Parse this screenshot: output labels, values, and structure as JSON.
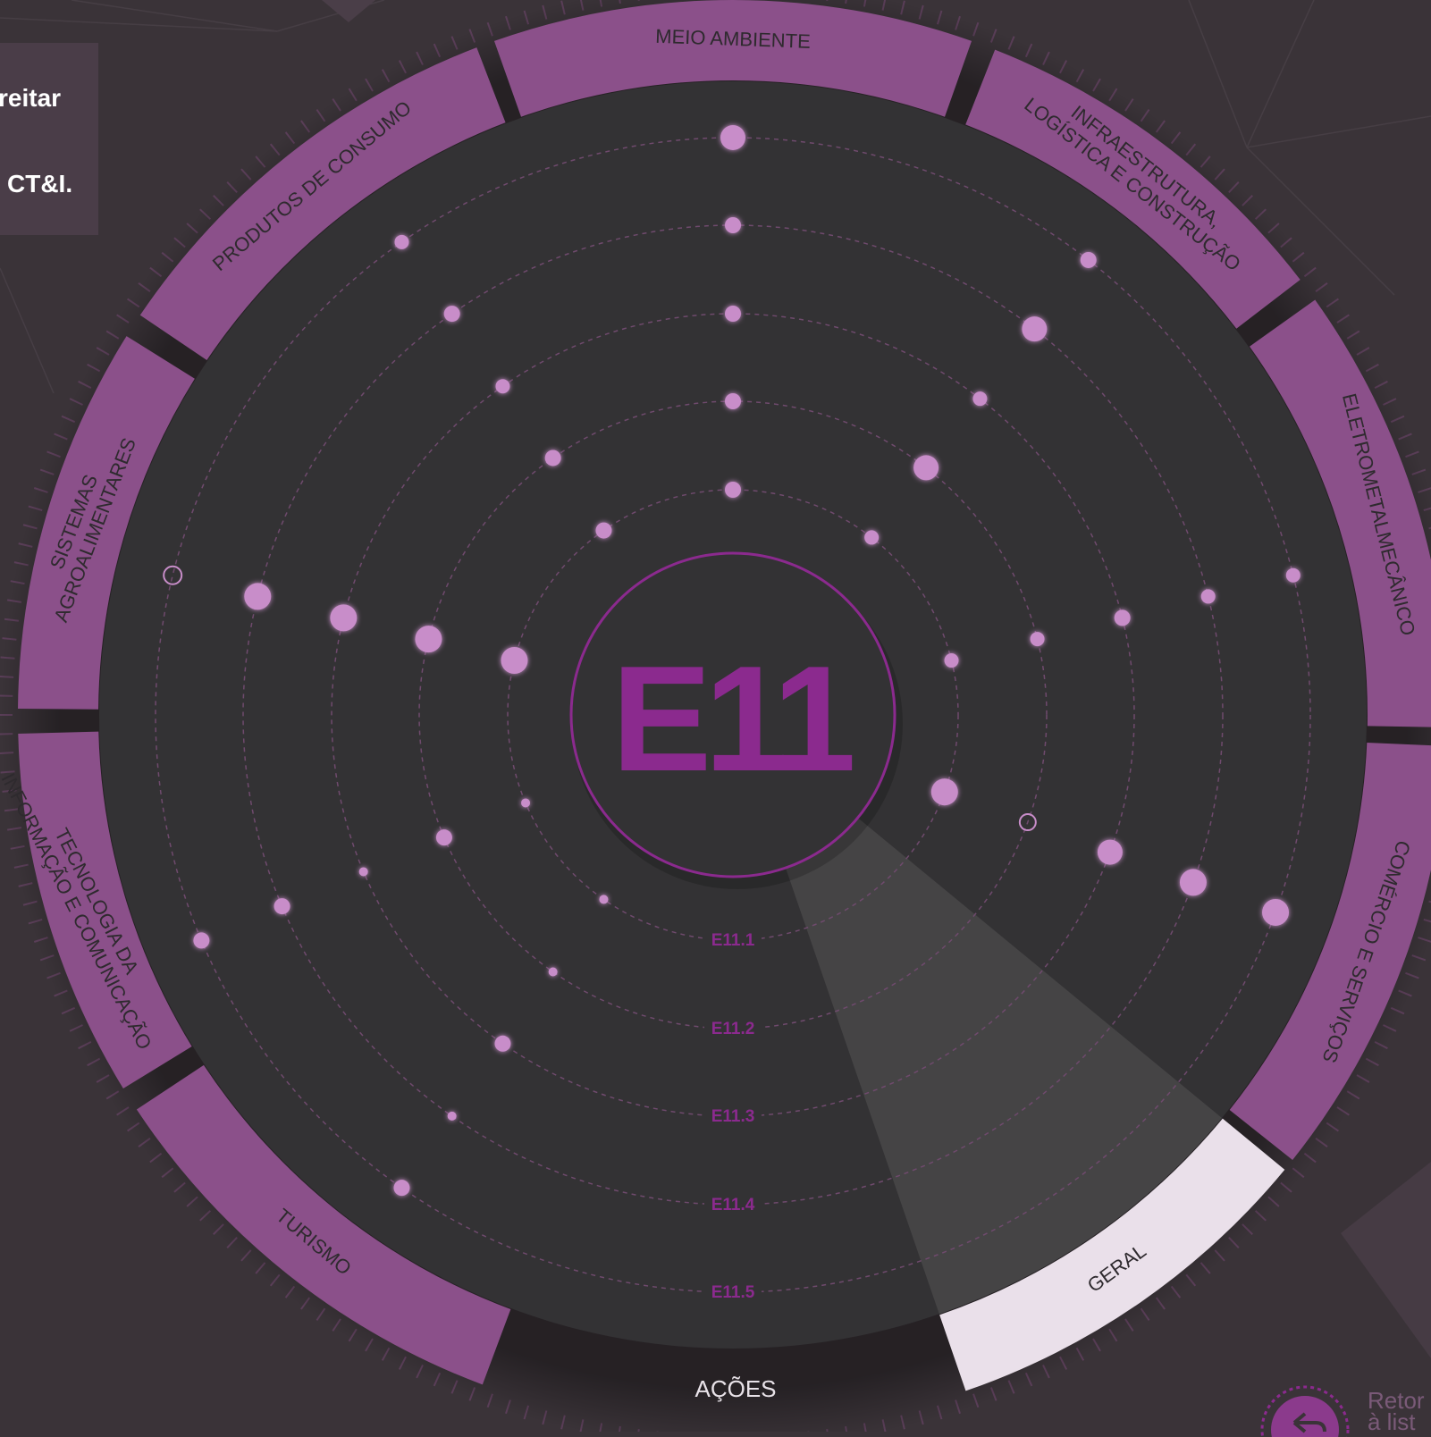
{
  "side_text": {
    "line1": "reitar",
    "line2": "CT&I."
  },
  "radar": {
    "center_label": "E11",
    "bottom_label": "AÇÕES",
    "rings": [
      "E11.1",
      "E11.2",
      "E11.3",
      "E11.4",
      "E11.5"
    ],
    "sectors": [
      {
        "label": "MEIO AMBIENTE",
        "highlight": false
      },
      {
        "label": "INFRAESTRUTURA,",
        "label2": "LOGÍSTICA E CONSTRUÇÃO",
        "highlight": false
      },
      {
        "label": "ELETROMETALMECÂNICO",
        "highlight": false
      },
      {
        "label": "COMÉRCIO E SERVIÇOS",
        "highlight": false
      },
      {
        "label": "GERAL",
        "highlight": true
      },
      {
        "label": "TURISMO",
        "highlight": false
      },
      {
        "label": "TECNOLOGIA DA",
        "label2": "INFORMAÇÃO E COMUNICAÇÃO",
        "highlight": false
      },
      {
        "label": "SISTEMAS",
        "label2": "AGROALIMENTARES",
        "highlight": false
      },
      {
        "label": "PRODUTOS DE CONSUMO",
        "highlight": false
      }
    ],
    "colors": {
      "background": "#3a3338",
      "inner_disc": "#333234",
      "sector": "#8b508a",
      "sector_highlight": "#eae0ea",
      "sector_text": "#2e2a2e",
      "accent": "#8b2a8e",
      "ring_line": "#6f4a6d",
      "dot": "#c88dc9",
      "highlight_wedge": "#474647"
    }
  },
  "back_link": {
    "line1": "Retor",
    "line2": "à list"
  }
}
